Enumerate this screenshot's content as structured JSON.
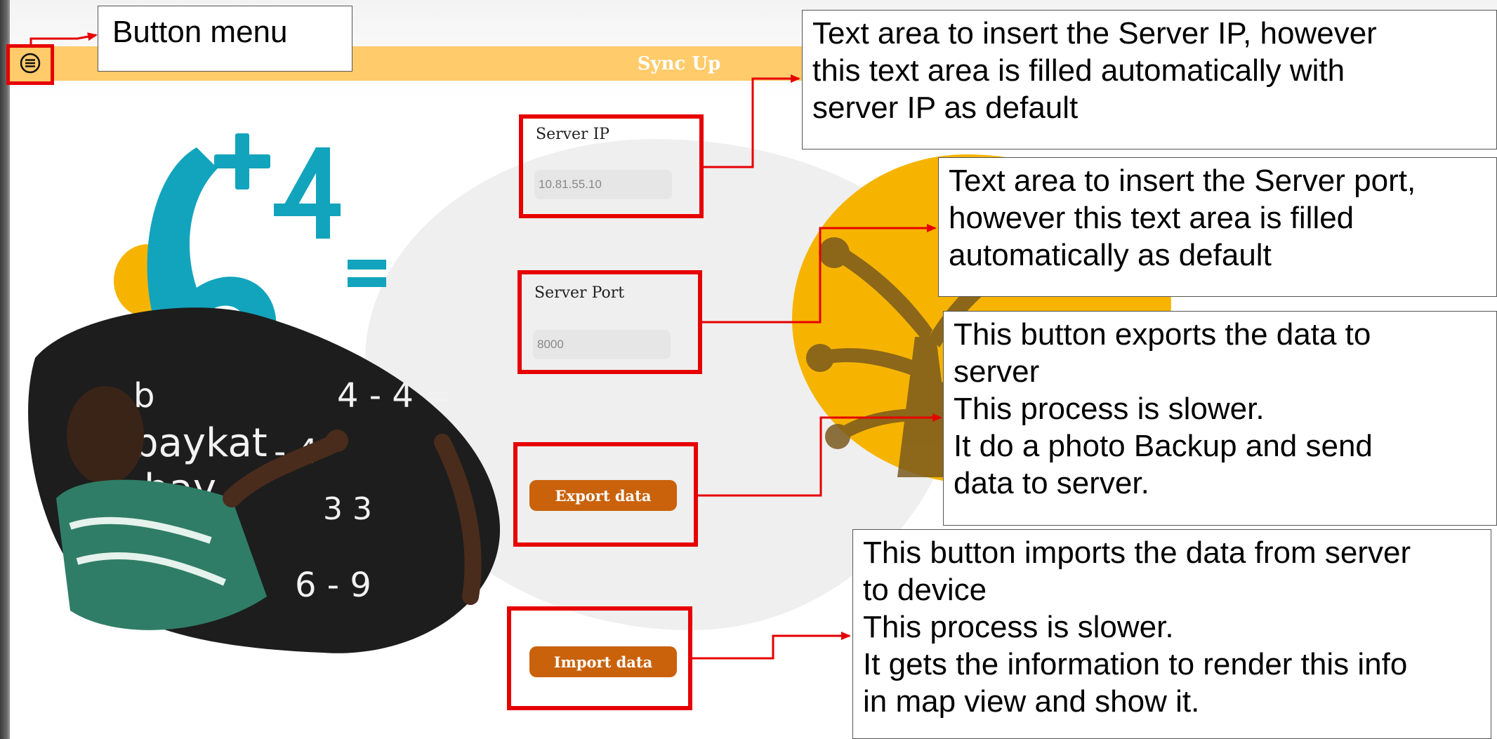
{
  "app": {
    "title": "Sync Up"
  },
  "menu": {
    "icon": "menu-lines-icon"
  },
  "form": {
    "server_ip": {
      "label": "Server IP",
      "value": "10.81.55.10"
    },
    "server_port": {
      "label": "Server Port",
      "value": "8000"
    },
    "export_label": "Export data",
    "import_label": "Import data"
  },
  "annotations": {
    "menu": "Button menu",
    "server_ip": "Text area to insert the Server IP, however\nthis text area is filled automatically with\nserver IP as default",
    "server_port": "Text area to insert the Server port,\nhowever this text area is filled\nautomatically as default",
    "export": "This button exports the data to\nserver\nThis process is slower.\nIt do a photo Backup and send\ndata to server.",
    "import": "This button imports the data from server\nto device\nThis process is slower.\nIt gets the information to render this info\nin map view and show it."
  },
  "colors": {
    "accent": "#ffcb6b",
    "button": "#c9620b",
    "highlight": "#e60000",
    "decor_yellow": "#f6b400",
    "decor_teal": "#12a4bd"
  }
}
